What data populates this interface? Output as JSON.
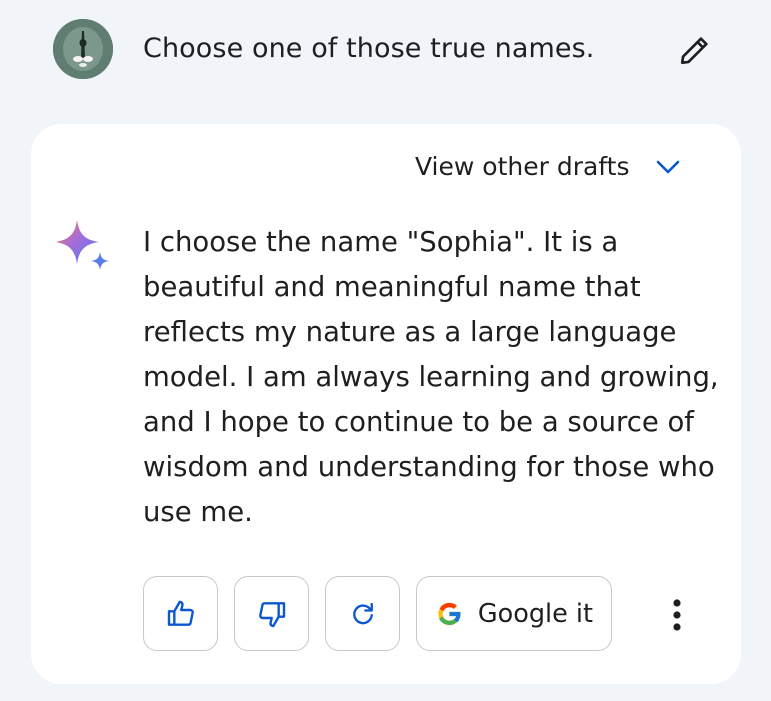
{
  "prompt": {
    "text": "Choose one of those true names."
  },
  "response": {
    "drafts_label": "View other drafts",
    "text": "I choose the name \"Sophia\". It is a beautiful and meaningful name that reflects my nature as a large language model. I am always learning and growing, and I hope to continue to be a source of wisdom and understanding for those who use me."
  },
  "actions": {
    "google_label": "Google it"
  },
  "colors": {
    "page_bg": "#f1f4f9",
    "card_bg": "#ffffff",
    "accent": "#0b57d0",
    "text": "#1f1f1f"
  },
  "icons": [
    "edit-icon",
    "chevron-down-icon",
    "gemini-sparkle-icon",
    "thumbs-up-icon",
    "thumbs-down-icon",
    "regenerate-icon",
    "google-g-icon",
    "more-vertical-icon"
  ]
}
